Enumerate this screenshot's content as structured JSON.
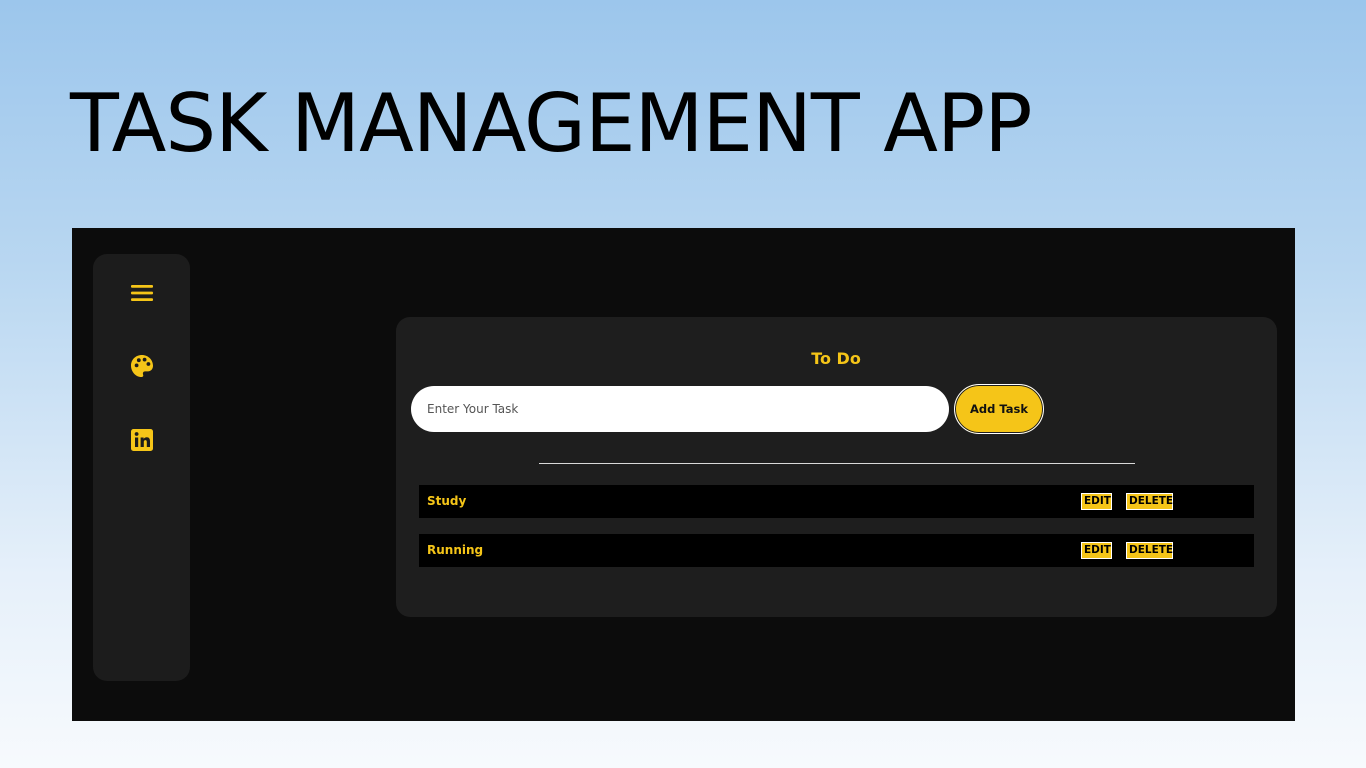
{
  "header": {
    "title": "TASK MANAGEMENT APP"
  },
  "sidebar": {
    "icons": [
      "menu-icon",
      "palette-icon",
      "linkedin-icon"
    ]
  },
  "todo": {
    "heading": "To Do",
    "input_value": "",
    "input_placeholder": "Enter Your Task",
    "add_label": "Add Task",
    "tasks": [
      {
        "name": "Study",
        "edit_label": "EDIT",
        "delete_label": "DELETE"
      },
      {
        "name": "Running",
        "edit_label": "EDIT",
        "delete_label": "DELETE"
      }
    ]
  },
  "colors": {
    "accent": "#f5c518",
    "frame_background": "#0c0c0c",
    "panel_background": "#1e1e1e",
    "row_background": "#000000",
    "page_gradient_top": "#9cc6ec",
    "page_gradient_bottom": "#f7fafd"
  }
}
